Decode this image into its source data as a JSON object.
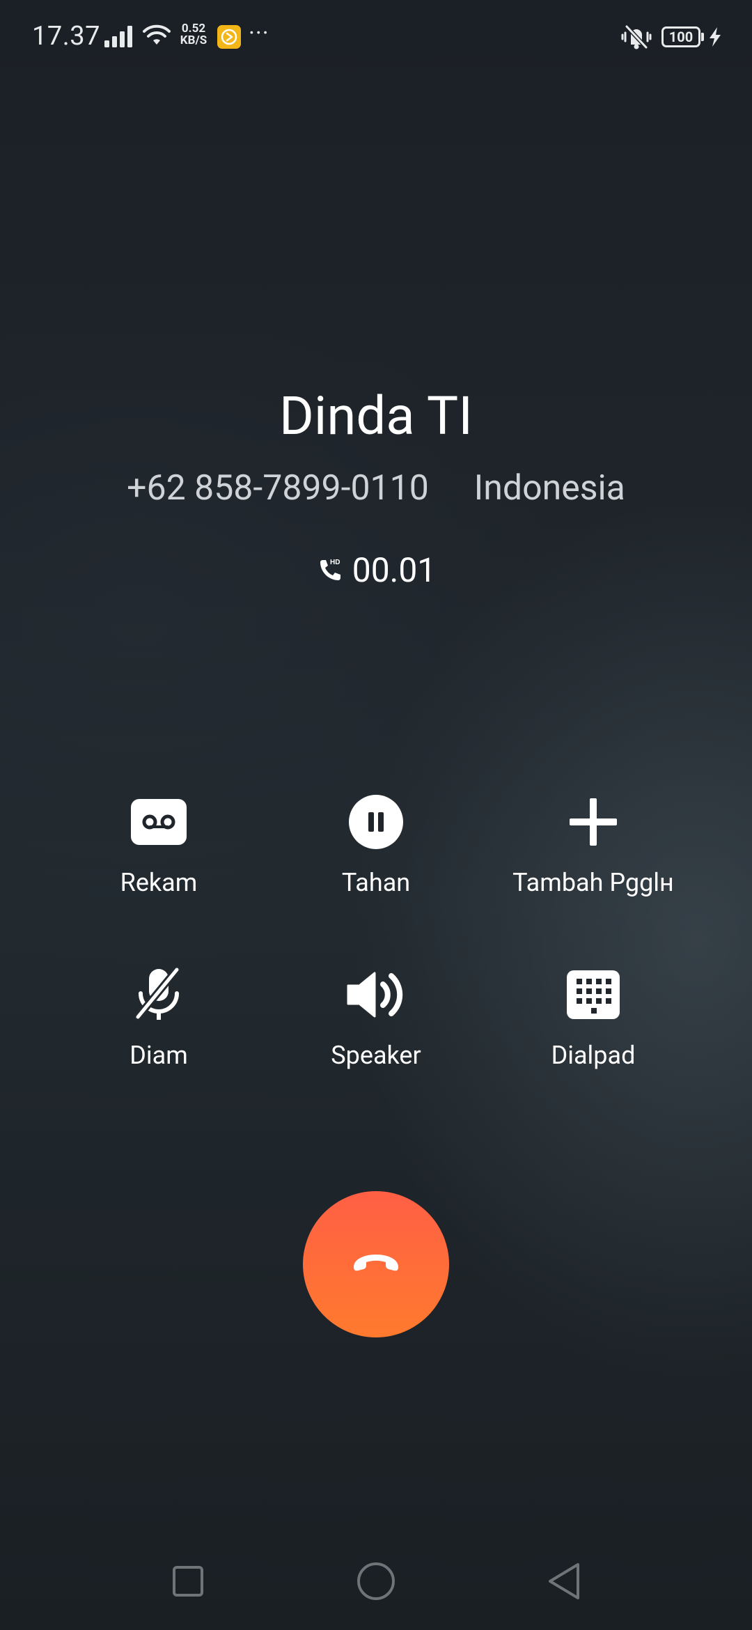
{
  "status_bar": {
    "time": "17.37",
    "net_speed_value": "0.52",
    "net_speed_unit": "KB/S",
    "more_dots": "···",
    "battery_level": "100",
    "icons": [
      "signal-icon",
      "wifi-icon",
      "app-notification-icon",
      "vibrate-off-icon",
      "battery-icon",
      "charging-icon"
    ]
  },
  "caller": {
    "name": "Dinda TI",
    "number": "+62 858-7899-0110",
    "location": "Indonesia"
  },
  "call": {
    "duration": "00.01",
    "hd_badge": "HD"
  },
  "actions": {
    "record": {
      "label": "Rekam",
      "icon": "record-icon"
    },
    "hold": {
      "label": "Tahan",
      "icon": "pause-icon"
    },
    "add_call": {
      "label": "Tambah Pgglн",
      "icon": "plus-icon"
    },
    "mute": {
      "label": "Diam",
      "icon": "mic-off-icon"
    },
    "speaker": {
      "label": "Speaker",
      "icon": "speaker-icon"
    },
    "dialpad": {
      "label": "Dialpad",
      "icon": "dialpad-icon"
    }
  },
  "end_call": {
    "icon": "hang-up-icon"
  },
  "nav_bar": {
    "recent": "recent-apps-icon",
    "home": "home-icon",
    "back": "back-icon"
  },
  "colors": {
    "end_call_top": "#ff5f45",
    "end_call_bottom": "#ff7a2e",
    "app_badge": "#f2b619",
    "background": "#1f252b"
  }
}
